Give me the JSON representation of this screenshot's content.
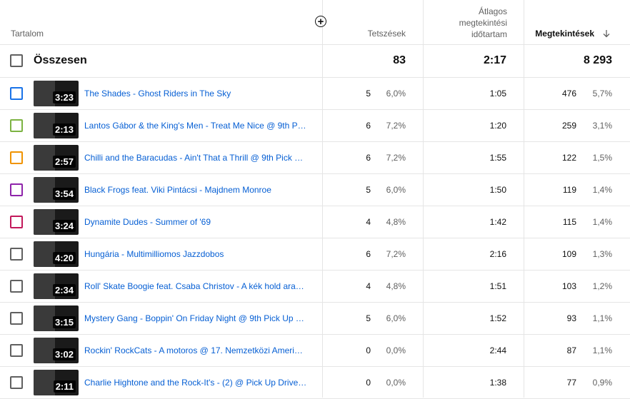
{
  "header": {
    "content": "Tartalom",
    "likes": "Tetszések",
    "avg_duration_l1": "Átlagos",
    "avg_duration_l2": "megtekintési",
    "avg_duration_l3": "időtartam",
    "views": "Megtekintések",
    "sort_icon": "arrow-down-icon",
    "add_icon": "plus-circle-icon"
  },
  "total": {
    "label": "Összesen",
    "likes": "83",
    "avg_duration": "2:17",
    "views": "8 293"
  },
  "rows": [
    {
      "title": "The Shades - Ghost Riders in The Sky",
      "duration": "3:23",
      "likes": "5",
      "likes_pct": "6,0%",
      "avg": "1:05",
      "views": "476",
      "views_pct": "5,7%",
      "color": "#1a73e8"
    },
    {
      "title": "Lantos Gábor & the King's Men - Treat Me Nice @ 9th P…",
      "duration": "2:13",
      "likes": "6",
      "likes_pct": "7,2%",
      "avg": "1:20",
      "views": "259",
      "views_pct": "3,1%",
      "color": "#7cb342"
    },
    {
      "title": "Chilli and the Baracudas - Ain't That a Thrill @ 9th Pick …",
      "duration": "2:57",
      "likes": "6",
      "likes_pct": "7,2%",
      "avg": "1:55",
      "views": "122",
      "views_pct": "1,5%",
      "color": "#f09300"
    },
    {
      "title": "Black Frogs feat. Viki Pintácsi - Majdnem Monroe",
      "duration": "3:54",
      "likes": "5",
      "likes_pct": "6,0%",
      "avg": "1:50",
      "views": "119",
      "views_pct": "1,4%",
      "color": "#8e24aa"
    },
    {
      "title": "Dynamite Dudes - Summer of '69",
      "duration": "3:24",
      "likes": "4",
      "likes_pct": "4,8%",
      "avg": "1:42",
      "views": "115",
      "views_pct": "1,4%",
      "color": "#c2185b"
    },
    {
      "title": "Hungária - Multimilliomos Jazzdobos",
      "duration": "4:20",
      "likes": "6",
      "likes_pct": "7,2%",
      "avg": "2:16",
      "views": "109",
      "views_pct": "1,3%",
      "color": "#606060"
    },
    {
      "title": "Roll' Skate Boogie feat. Csaba Christov - A kék hold ara…",
      "duration": "2:34",
      "likes": "4",
      "likes_pct": "4,8%",
      "avg": "1:51",
      "views": "103",
      "views_pct": "1,2%",
      "color": "#606060"
    },
    {
      "title": "Mystery Gang - Boppin' On Friday Night @ 9th Pick Up …",
      "duration": "3:15",
      "likes": "5",
      "likes_pct": "6,0%",
      "avg": "1:52",
      "views": "93",
      "views_pct": "1,1%",
      "color": "#606060"
    },
    {
      "title": "Rockin' RockCats - A motoros @ 17. Nemzetközi Ameri…",
      "duration": "3:02",
      "likes": "0",
      "likes_pct": "0,0%",
      "avg": "2:44",
      "views": "87",
      "views_pct": "1,1%",
      "color": "#606060"
    },
    {
      "title": "Charlie Hightone and the Rock-It's - (2) @ Pick Up Drive…",
      "duration": "2:11",
      "likes": "0",
      "likes_pct": "0,0%",
      "avg": "1:38",
      "views": "77",
      "views_pct": "0,9%",
      "color": "#606060"
    }
  ]
}
